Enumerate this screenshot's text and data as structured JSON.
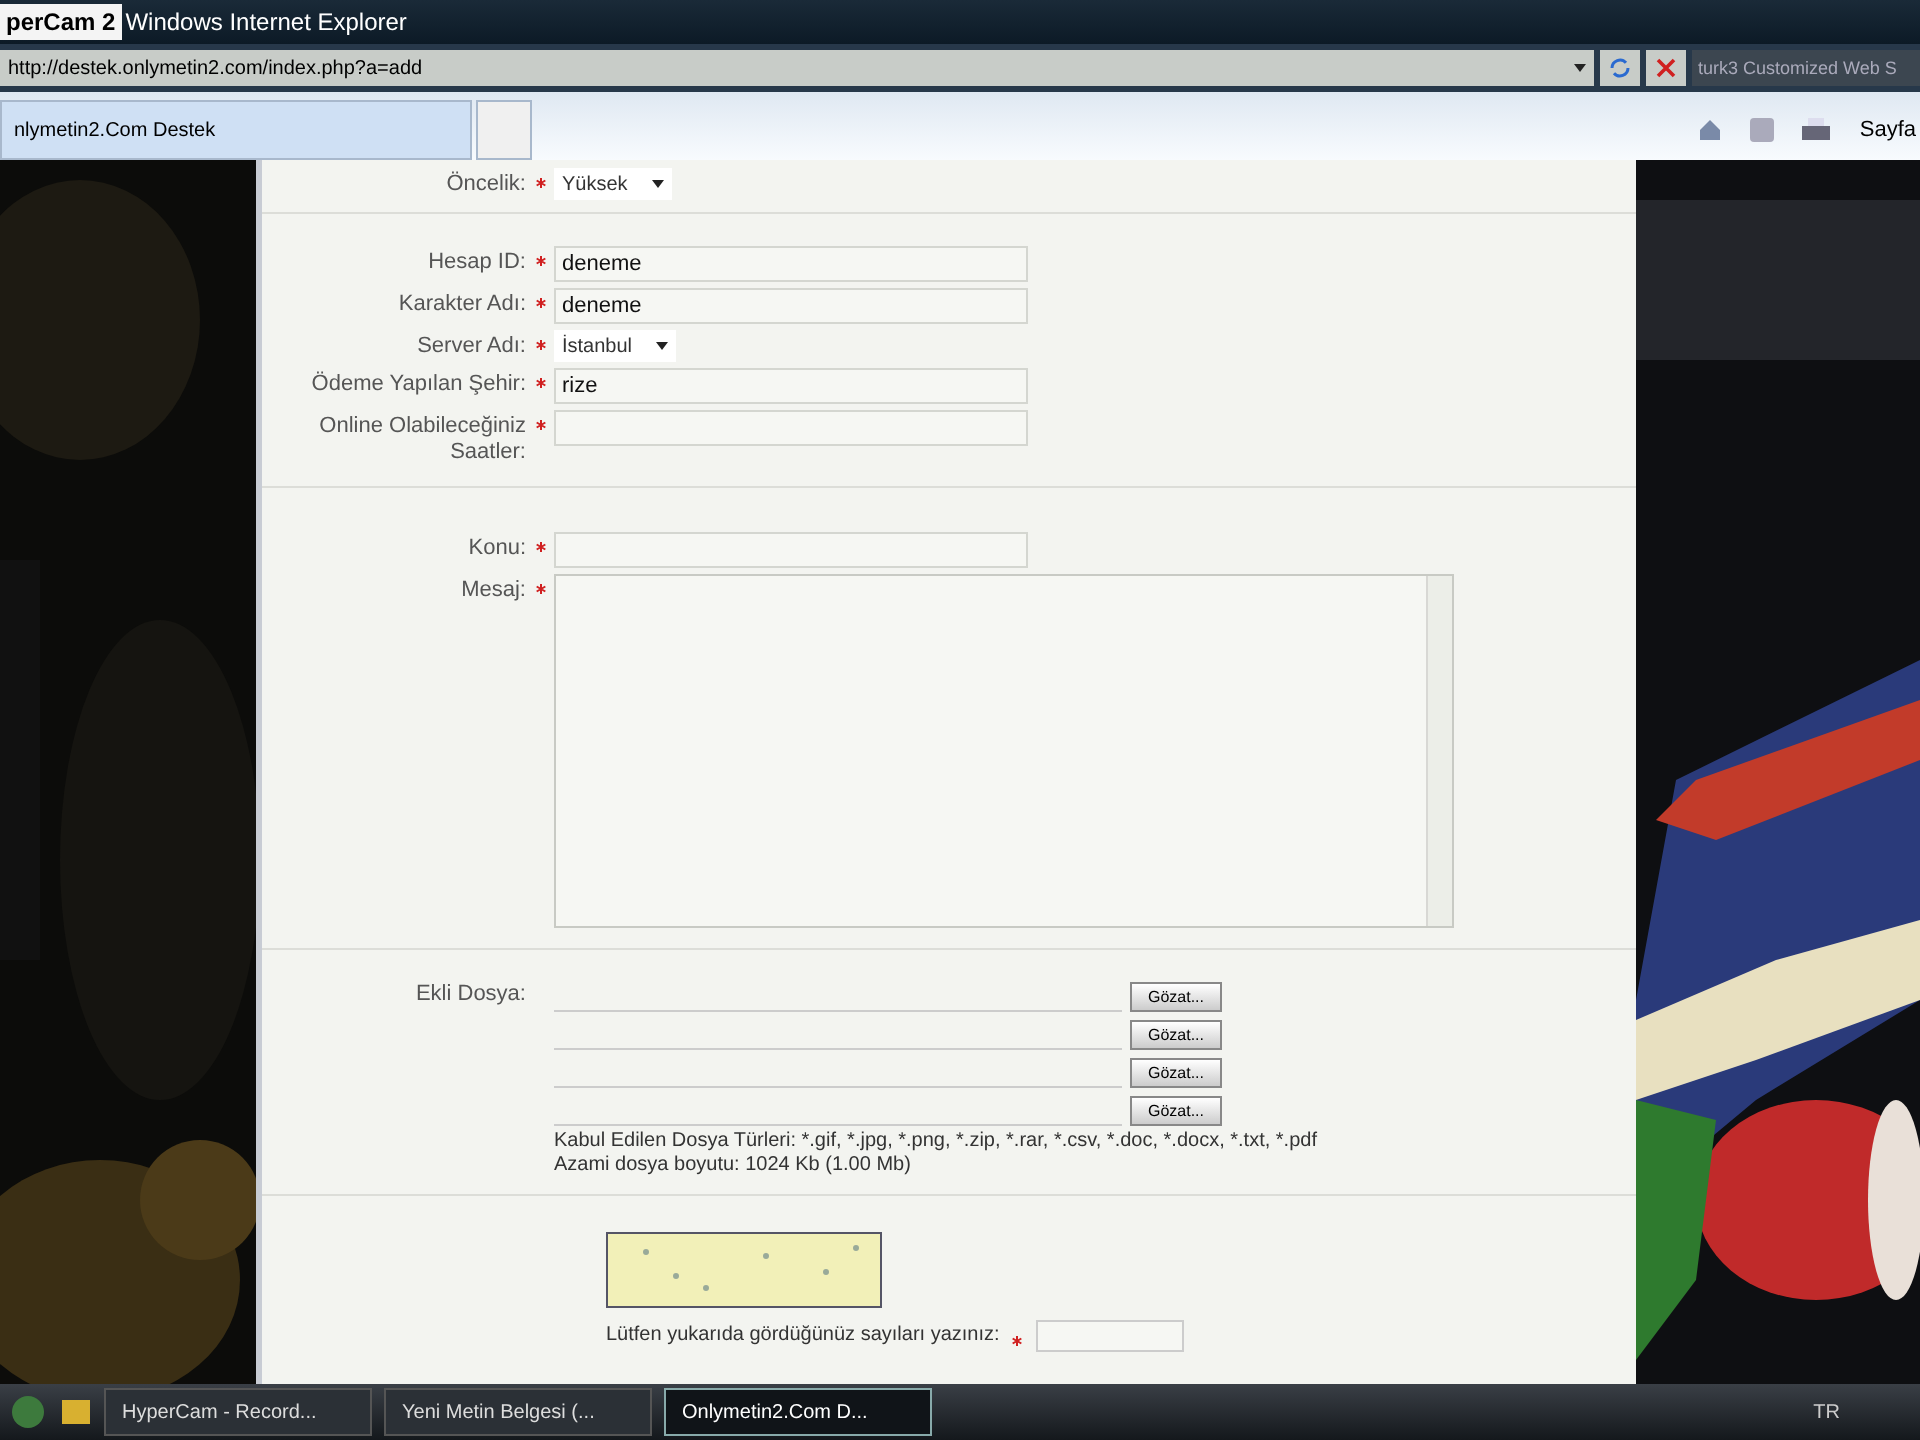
{
  "overlay_label": "perCam 2",
  "window": {
    "title": "Windows Internet Explorer"
  },
  "address_bar": {
    "url": "http://destek.onlymetin2.com/index.php?a=add"
  },
  "search": {
    "placeholder": "turk3 Customized Web S"
  },
  "tabs": [
    {
      "label": "nlymetin2.Com Destek",
      "selected": true
    },
    {
      "selected": false
    }
  ],
  "toolbar": {
    "page_menu": "Sayfa"
  },
  "sections": [
    {
      "fields": [
        {
          "kind": "select",
          "label": "Öncelik:",
          "required": true,
          "value": "Yüksek"
        }
      ]
    },
    {
      "fields": [
        {
          "kind": "input",
          "label": "Hesap ID:",
          "required": true,
          "value": "deneme"
        },
        {
          "kind": "input",
          "label": "Karakter Adı:",
          "required": true,
          "value": "deneme"
        },
        {
          "kind": "select",
          "label": "Server Adı:",
          "required": true,
          "value": "İstanbul"
        },
        {
          "kind": "input",
          "label": "Ödeme Yapılan Şehir:",
          "required": true,
          "value": "rize"
        },
        {
          "kind": "input",
          "label": "Online Olabileceğiniz Saatler:",
          "required": true
        }
      ]
    },
    {
      "fields": [
        {
          "kind": "input",
          "label": "Konu:",
          "required": true
        },
        {
          "kind": "textarea",
          "label": "Mesaj:",
          "required": true
        }
      ]
    }
  ],
  "attachments": {
    "label": "Ekli Dosya:",
    "buttons": [
      "Gözat...",
      "Gözat...",
      "Gözat...",
      "Gözat..."
    ],
    "accepted": "Kabul Edilen Dosya Türleri: *.gif, *.jpg, *.png, *.zip, *.rar, *.csv, *.doc, *.docx, *.txt, *.pdf",
    "max_size": "Azami dosya boyutu: 1024 Kb (1.00 Mb)"
  },
  "captcha": {
    "prompt": "Lütfen yukarıda gördüğünüz sayıları yazınız:",
    "required": true
  },
  "taskbar": {
    "items": [
      {
        "label": "HyperCam - Record...",
        "selected": false
      },
      {
        "label": "Yeni Metin Belgesi (...",
        "selected": false
      },
      {
        "label": "Onlymetin2.Com D...",
        "selected": true
      }
    ],
    "language": "TR"
  }
}
